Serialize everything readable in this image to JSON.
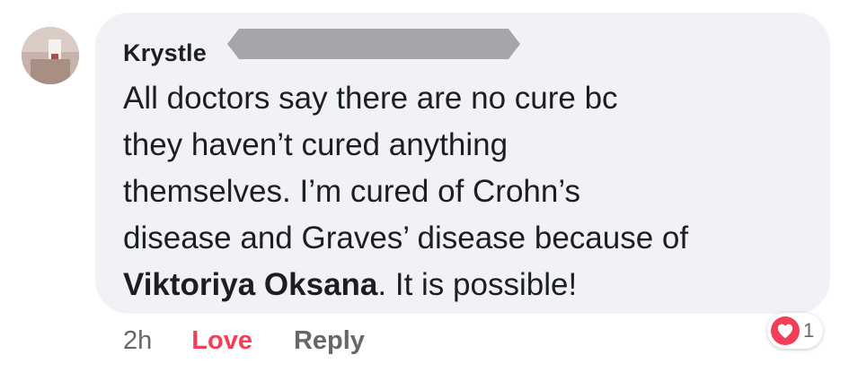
{
  "comment": {
    "author": "Krystle",
    "lines": [
      "All doctors say there are no cure bc",
      "they haven’t cured anything",
      "themselves. I’m cured of Crohn’s",
      "disease and Graves’ disease because of"
    ],
    "mention": "Viktoriya Oksana",
    "after_mention": ". It is possible!"
  },
  "actions": {
    "time": "2h",
    "love_label": "Love",
    "reply_label": "Reply"
  },
  "reactions": {
    "icon": "heart-icon",
    "count": "1"
  },
  "colors": {
    "bubble": "#f0f2f5",
    "love": "#f33e58",
    "secondary_text": "#65676b",
    "redaction": "#a4a6aa"
  }
}
